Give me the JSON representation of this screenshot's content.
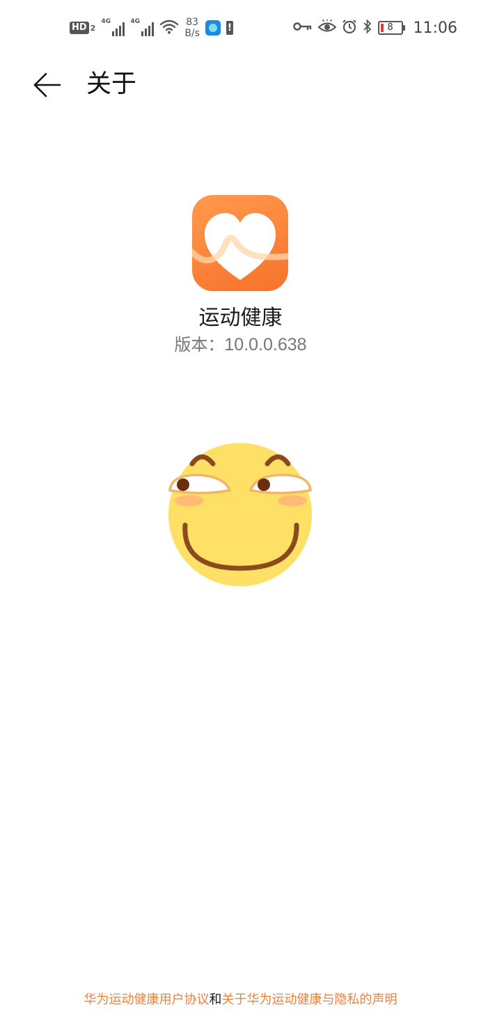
{
  "status_bar": {
    "hd_label": "HD",
    "hd_sim": "2",
    "network_1": "4G",
    "network_2": "4G",
    "net_speed_value": "83",
    "net_speed_unit": "B/s",
    "battery_level": "8",
    "time": "11:06",
    "icons": [
      "hd-icon",
      "signal-icon",
      "signal-icon",
      "wifi-icon",
      "app-notification-icon",
      "battery-alert-icon",
      "key-icon",
      "eye-icon",
      "alarm-icon",
      "bluetooth-icon",
      "battery-icon"
    ]
  },
  "header": {
    "back_icon": "arrow-left-icon",
    "title": "关于"
  },
  "app": {
    "icon": "heart-rate-app-icon",
    "name": "运动健康",
    "version_label": "版本：",
    "version_value": "10.0.0.638"
  },
  "emoji": {
    "icon": "smirk-emoji"
  },
  "footer": {
    "user_agreement": "华为运动健康用户协议",
    "conjunction": "和",
    "privacy_statement": "关于华为运动健康与隐私的声明"
  },
  "colors": {
    "accent": "#f0803a",
    "app_icon_top": "#ff9a4d",
    "app_icon_bottom": "#f7722b",
    "emoji_face": "#ffe066"
  }
}
